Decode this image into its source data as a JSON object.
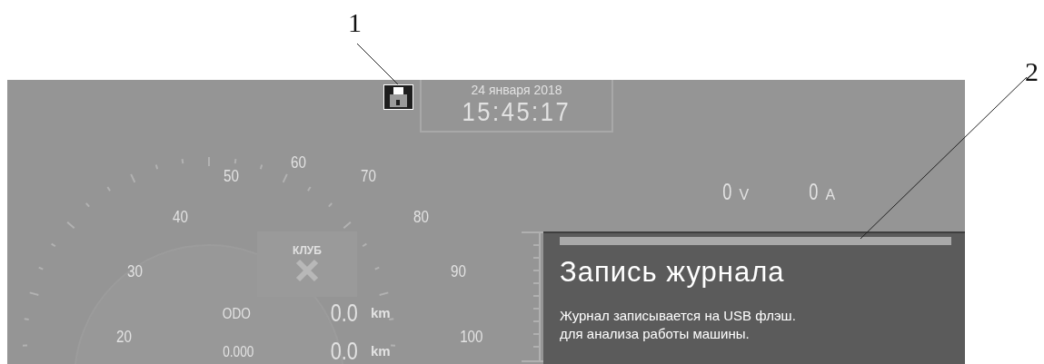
{
  "callouts": [
    {
      "label": "1"
    },
    {
      "label": "2"
    }
  ],
  "screen": {
    "date": "24 января 2018",
    "time": "15:45:17",
    "speedometer": {
      "scale_labels": [
        "20",
        "30",
        "40",
        "50",
        "60",
        "70",
        "80",
        "90",
        "100"
      ],
      "club_label": "КЛУБ",
      "odometer": [
        {
          "label": "ODO",
          "value": "0.0",
          "unit": "km"
        },
        {
          "label": "0.000",
          "value": "0.0",
          "unit": "km"
        }
      ]
    },
    "meters": [
      {
        "value": "0",
        "unit": "V"
      },
      {
        "value": "0",
        "unit": "A"
      }
    ],
    "dialog": {
      "title": "Запись журнала",
      "progress": {
        "level": 1
      },
      "message": [
        "Журнал записывается на USB флэш.",
        "для анализа работы машины."
      ]
    }
  }
}
